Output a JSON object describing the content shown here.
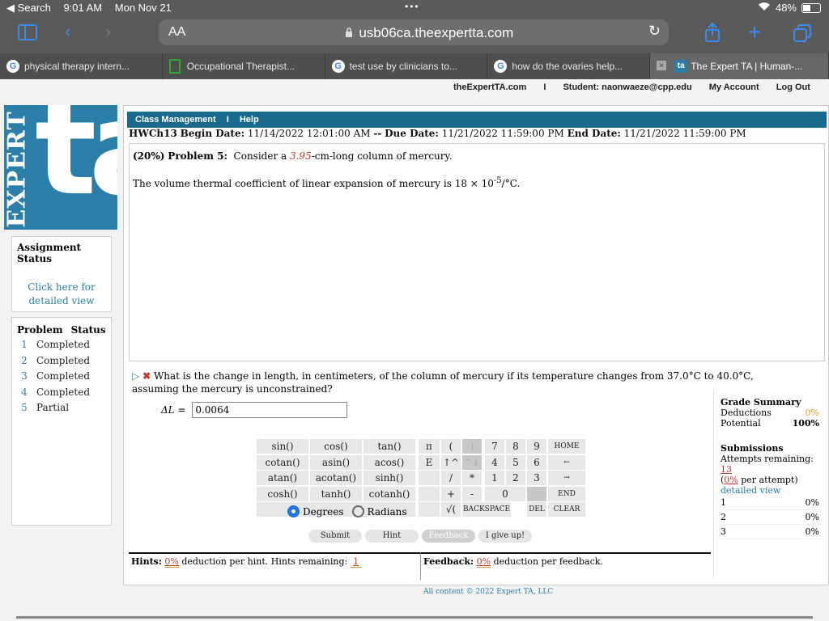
{
  "status": {
    "back": "◀ Search",
    "time": "9:01 AM",
    "date": "Mon Nov 21",
    "dots": "•••",
    "wifi": "⌔",
    "battery": "48%",
    "battery_level": 0.48
  },
  "toolbar": {
    "aa": "AA",
    "url": "usb06ca.theexpertta.com",
    "lock": "🔒"
  },
  "tabs": [
    {
      "label": "physical therapy intern..."
    },
    {
      "label": "Occupational Therapist..."
    },
    {
      "label": "test use by clinicians to..."
    },
    {
      "label": "how do the ovaries help..."
    },
    {
      "label": "The Expert TA | Human-..."
    }
  ],
  "toplinks": {
    "site": "theExpertTA.com",
    "sep": "I",
    "student": "Student: naonwaeze@cpp.edu",
    "account": "My Account",
    "logout": "Log Out"
  },
  "logo": {
    "expert": "EXPERT",
    "ta": "ta"
  },
  "assignment": {
    "title": "Assignment Status",
    "link": "Click here for detailed view"
  },
  "problems": {
    "header": [
      "Problem",
      "Status"
    ],
    "rows": [
      {
        "n": "1",
        "s": "Completed"
      },
      {
        "n": "2",
        "s": "Completed"
      },
      {
        "n": "3",
        "s": "Completed"
      },
      {
        "n": "4",
        "s": "Completed"
      },
      {
        "n": "5",
        "s": "Partial"
      }
    ]
  },
  "nav": {
    "class_mgmt": "Class Management",
    "sep": "I",
    "help": "Help"
  },
  "dates": {
    "hw": "HWCh13",
    "begin_label": "Begin Date:",
    "begin": "11/14/2022 12:01:00 AM",
    "dash": "--",
    "due_label": "Due Date:",
    "due": "11/21/2022 11:59:00 PM",
    "end_label": "End Date:",
    "end": "11/21/2022 11:59:00 PM"
  },
  "problem": {
    "pct": "(20%)",
    "label": "Problem 5:",
    "text_a": "Consider a",
    "value": "3.95",
    "text_b": "-cm-long column of mercury.",
    "coef_a": "The volume thermal coefficient of linear expansion of mercury is 18 × 10",
    "coef_exp": "-5",
    "coef_b": "/°C."
  },
  "question": {
    "text": "What is the change in length, in centimeters, of the column of mercury if its temperature changes from 37.0°C to 40.0°C, assuming the mercury is unconstrained?",
    "var": "ΔL =",
    "answer": "0.0064"
  },
  "calc": {
    "funcs": [
      "sin()",
      "cos()",
      "tan()",
      "cotan()",
      "asin()",
      "acos()",
      "atan()",
      "acotan()",
      "sinh()",
      "cosh()",
      "tanh()",
      "cotanh()"
    ],
    "consts": [
      "π",
      "E",
      "",
      ""
    ],
    "ops": [
      "(",
      ")",
      "↑^",
      "^↓",
      "/",
      "*",
      "+",
      "-",
      "√(",
      "BACKSPACE"
    ],
    "digits": [
      "7",
      "8",
      "9",
      "4",
      "5",
      "6",
      "1",
      "2",
      "3",
      "0"
    ],
    "nav": [
      "HOME",
      "←",
      "→",
      "END",
      "DEL",
      "CLEAR"
    ],
    "degrees": "Degrees",
    "radians": "Radians"
  },
  "actions": {
    "submit": "Submit",
    "hint": "Hint",
    "feedback": "Feedback",
    "giveup": "I give up!"
  },
  "hints": {
    "label": "Hints:",
    "pct": "0%",
    "text": "deduction per hint. Hints remaining:",
    "remaining": "1"
  },
  "feedback": {
    "label": "Feedback:",
    "pct": "0%",
    "text": "deduction per feedback."
  },
  "grade": {
    "title": "Grade Summary",
    "deductions_label": "Deductions",
    "deductions": "0%",
    "potential_label": "Potential",
    "potential": "100%",
    "sub_title": "Submissions",
    "attempts_label": "Attempts remaining:",
    "attempts": "13",
    "per_attempt_pct": "0%",
    "per_attempt": "per attempt)",
    "detail": "detailed view",
    "rows": [
      {
        "n": "1",
        "v": "0%"
      },
      {
        "n": "2",
        "v": "0%"
      },
      {
        "n": "3",
        "v": "0%"
      }
    ]
  },
  "footer": "All content © 2022 Expert TA, LLC",
  "colors": {
    "brand": "#2a7ea8",
    "nav": "#1a6a8e",
    "accent": "#c0392b",
    "safari_blue": "#3c8cf0"
  }
}
